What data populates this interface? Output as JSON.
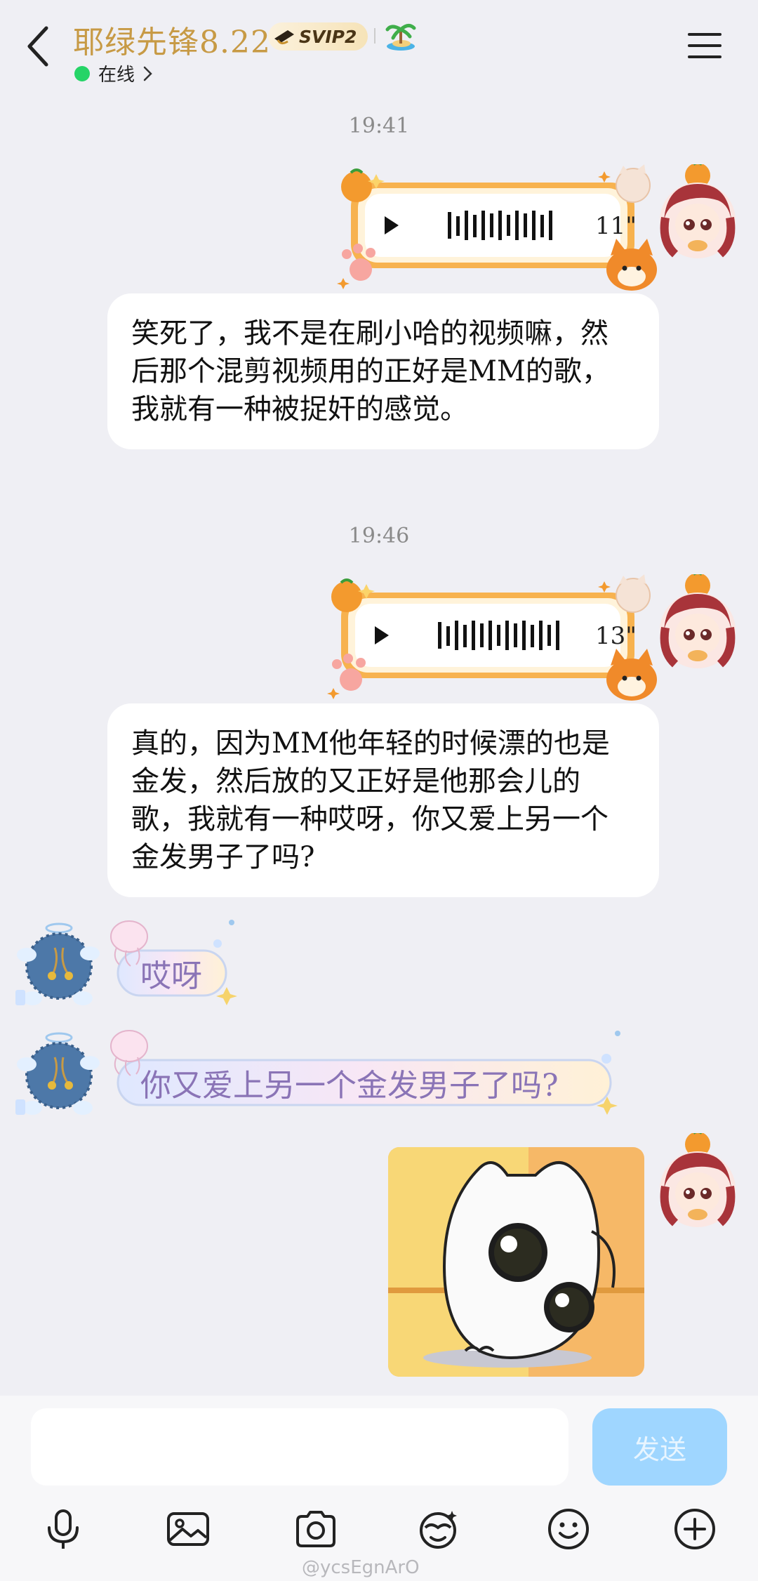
{
  "header": {
    "contact_name": "耶绿先锋8.22",
    "vip_badge": "SVIP2",
    "status": "在线"
  },
  "messages": {
    "time_1": "19:41",
    "voice_1_duration": "11\"",
    "text_1": "笑死了，我不是在刷小哈的视频嘛，然后那个混剪视频用的正好是MM的歌，我就有一种被捉奸的感觉。",
    "time_2": "19:46",
    "voice_2_duration": "13\"",
    "text_2": "真的，因为MM他年轻的时候漂的也是金发，然后放的又正好是他那会儿的歌，我就有一种哎呀，你又爱上另一个金发男子了吗?",
    "friend_text_1": "哎呀",
    "friend_text_2": "你又爱上另一个金发男子了吗?"
  },
  "input": {
    "placeholder": "",
    "send_label": "发送"
  },
  "watermark": "@ycsEgnArO",
  "colors": {
    "background": "#efeff4",
    "name_gold": "#c79a45",
    "online_green": "#25d467",
    "send_button": "#9fd6ff",
    "deco_text_purple": "#8a74b6",
    "voice_frame_orange": "#f2a03c"
  },
  "icons": {
    "back": "chevron-left-icon",
    "menu": "hamburger-menu-icon",
    "toolbar": [
      "microphone-icon",
      "image-icon",
      "camera-icon",
      "sticker-face-icon",
      "emoji-icon",
      "plus-icon"
    ]
  }
}
